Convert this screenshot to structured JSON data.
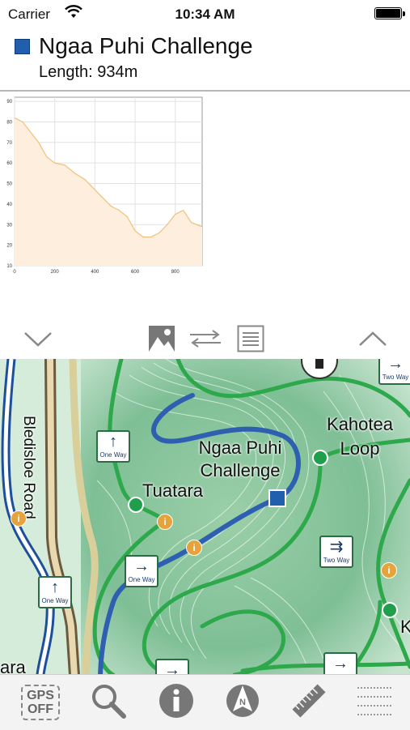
{
  "status": {
    "carrier": "Carrier",
    "time": "10:34 AM"
  },
  "route": {
    "name": "Ngaa Puhi Challenge",
    "length": "Length: 934m",
    "color": "#1f5fae"
  },
  "chart_data": {
    "type": "area",
    "x": [
      0,
      40,
      80,
      120,
      160,
      200,
      250,
      300,
      350,
      400,
      440,
      480,
      520,
      560,
      600,
      640,
      680,
      720,
      760,
      800,
      840,
      880,
      934
    ],
    "values": [
      82,
      80,
      75,
      70,
      63,
      60,
      59,
      55,
      52,
      47,
      43,
      39,
      37,
      34,
      27,
      24,
      24,
      26,
      30,
      35,
      37,
      31,
      29
    ],
    "xlim": [
      0,
      934
    ],
    "ylim": [
      10,
      92
    ],
    "xticks": [
      0,
      200,
      400,
      600,
      800
    ],
    "yticks": [
      10,
      20,
      30,
      40,
      50,
      60,
      70,
      80,
      90
    ],
    "fill_color": "#fdeedd",
    "line_color": "#f0c07a",
    "grid": true
  },
  "map": {
    "road_label": "Bledisloe Road",
    "track_labels": {
      "tuatara": "Tuatara",
      "kahotea": "Kahotea Loop",
      "challenge": "Ngaa Puhi Challenge",
      "partial_left": "ara",
      "partial_right": "K"
    },
    "sign_one_way": "One Way",
    "sign_two_way": "Two Way",
    "info_glyph": "i"
  },
  "toolbar": {
    "gps_line1": "GPS",
    "gps_line2": "OFF"
  }
}
